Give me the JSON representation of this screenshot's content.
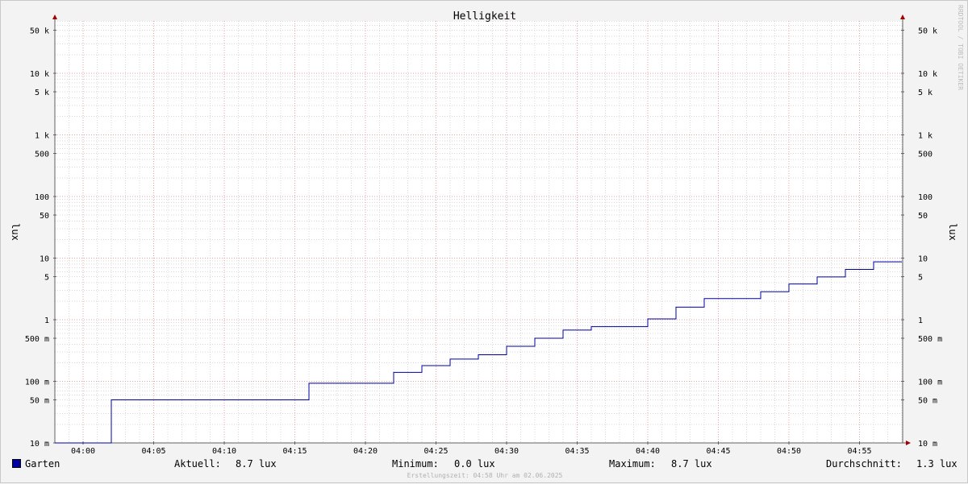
{
  "chart_data": {
    "type": "line",
    "title": "Helligkeit",
    "ylabel": "lux",
    "ylabel_right": "lux",
    "yscale": "log",
    "ylim": [
      10,
      70000
    ],
    "y_ticks": [
      {
        "label": "50 k",
        "value": 50000
      },
      {
        "label": "10 k",
        "value": 10000
      },
      {
        "label": "5 k",
        "value": 5000
      },
      {
        "label": "1 k",
        "value": 1000
      },
      {
        "label": "500",
        "value": 500
      },
      {
        "label": "100",
        "value": 100
      },
      {
        "label": "50",
        "value": 50
      },
      {
        "label": "10",
        "value": 10
      },
      {
        "label": "5",
        "value": 5
      },
      {
        "label": "1",
        "value": 1
      },
      {
        "label": "500 m",
        "value": 0.5
      },
      {
        "label": "100 m",
        "value": 0.1
      },
      {
        "label": "50 m",
        "value": 0.05
      },
      {
        "label": "10 m",
        "value": 0.01
      }
    ],
    "x_ticks": [
      "04:00",
      "04:05",
      "04:10",
      "04:15",
      "04:20",
      "04:25",
      "04:30",
      "04:35",
      "04:40",
      "04:45",
      "04:50",
      "04:55"
    ],
    "grid": true,
    "series": [
      {
        "name": "Garten",
        "color": "#0000a0",
        "step": true,
        "points": [
          [
            "03:58",
            0.01
          ],
          [
            "04:02",
            0.05
          ],
          [
            "04:16",
            0.093
          ],
          [
            "04:22",
            0.14
          ],
          [
            "04:24",
            0.18
          ],
          [
            "04:26",
            0.23
          ],
          [
            "04:28",
            0.27
          ],
          [
            "04:30",
            0.37
          ],
          [
            "04:32",
            0.5
          ],
          [
            "04:34",
            0.68
          ],
          [
            "04:36",
            0.77
          ],
          [
            "04:40",
            1.03
          ],
          [
            "04:42",
            1.6
          ],
          [
            "04:44",
            2.2
          ],
          [
            "04:48",
            2.85
          ],
          [
            "04:50",
            3.8
          ],
          [
            "04:52",
            4.95
          ],
          [
            "04:54",
            6.55
          ],
          [
            "04:56",
            8.7
          ],
          [
            "04:58",
            8.7
          ]
        ]
      }
    ]
  },
  "legend": {
    "series_name": "Garten",
    "aktuell_label": "Aktuell:",
    "aktuell_value": "8.7 lux",
    "minimum_label": "Minimum:",
    "minimum_value": "0.0 lux",
    "maximum_label": "Maximum:",
    "maximum_value": "8.7 lux",
    "durchschnitt_label": "Durchschnitt:",
    "durchschnitt_value": "1.3 lux"
  },
  "footer": "Erstellungszeit: 04:58 Uhr am 02.06.2025",
  "watermark": "RRDTOOL / TOBI OETIKER"
}
